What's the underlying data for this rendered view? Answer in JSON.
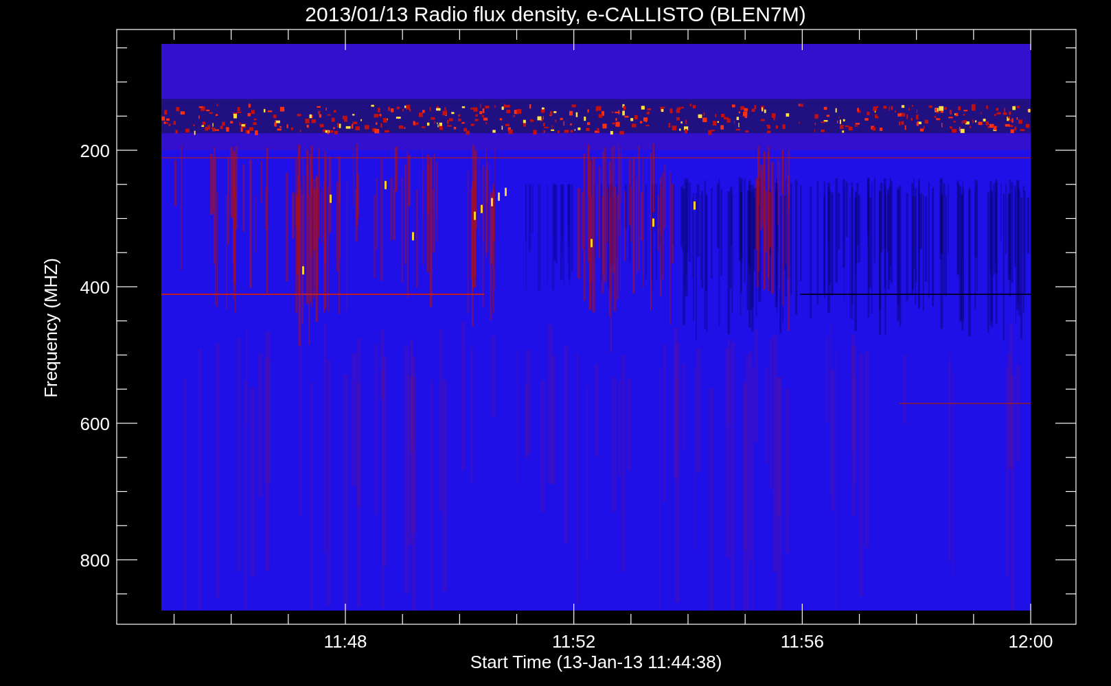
{
  "title": "2013/01/13  Radio flux density, e-CALLISTO (BLEN7M)",
  "y_axis": {
    "label": "Frequency (MHZ)",
    "ticks": [
      "200",
      "400",
      "600",
      "800"
    ]
  },
  "x_axis": {
    "label": "Start Time (13-Jan-13 11:44:38)",
    "ticks": [
      "11:48",
      "11:52",
      "11:56",
      "12:00"
    ]
  }
}
